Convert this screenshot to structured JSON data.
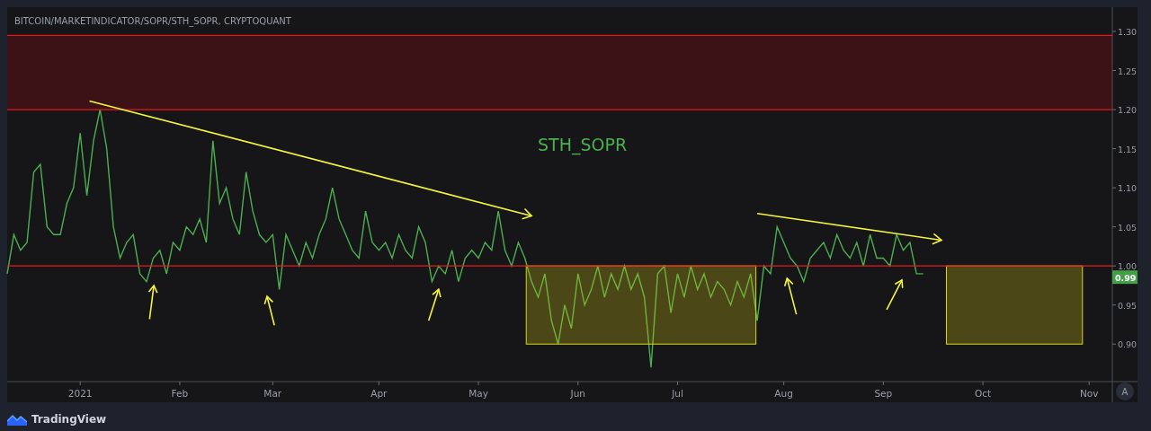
{
  "chart": {
    "chart_data": {
      "type": "line",
      "title": "BITCOIN/MARKETINDICATOR/SOPR/STH_SOPR, CRYPTOQUANT",
      "categories": [
        null,
        null,
        null,
        null,
        null,
        null,
        null,
        null,
        null,
        null,
        null,
        "2021",
        null,
        null,
        null,
        null,
        null,
        null,
        null,
        null,
        null,
        null,
        null,
        null,
        null,
        null,
        "Feb",
        null,
        null,
        null,
        null,
        null,
        null,
        null,
        null,
        null,
        null,
        null,
        null,
        null,
        "Mar",
        null,
        null,
        null,
        null,
        null,
        null,
        null,
        null,
        null,
        null,
        null,
        null,
        null,
        null,
        null,
        "Apr",
        null,
        null,
        null,
        null,
        null,
        null,
        null,
        null,
        null,
        null,
        null,
        null,
        null,
        null,
        "May",
        null,
        null,
        null,
        null,
        null,
        null,
        null,
        null,
        null,
        null,
        null,
        null,
        null,
        null,
        "Jun",
        null,
        null,
        null,
        null,
        null,
        null,
        null,
        null,
        null,
        null,
        null,
        null,
        null,
        null,
        "Jul",
        null,
        null,
        null,
        null,
        null,
        null,
        null,
        null,
        null,
        null,
        null,
        null,
        null,
        null,
        null,
        "Aug",
        null,
        null,
        null,
        null,
        null,
        null,
        null,
        null,
        null,
        null,
        null,
        null,
        null,
        null,
        "Sep",
        null,
        null,
        null,
        null,
        null,
        null,
        null,
        null,
        null,
        null,
        null,
        null,
        null,
        null,
        "Oct",
        null,
        null,
        null,
        null,
        null,
        null,
        null,
        null,
        null,
        null,
        null,
        null,
        null,
        null,
        null,
        "Nov",
        null,
        null,
        null
      ],
      "series": [
        {
          "name": "STH_SOPR",
          "color": "#4caf50",
          "values": [
            0.99,
            1.04,
            1.02,
            1.03,
            1.12,
            1.13,
            1.05,
            1.04,
            1.04,
            1.08,
            1.1,
            1.17,
            1.09,
            1.16,
            1.2,
            1.15,
            1.05,
            1.01,
            1.03,
            1.04,
            0.99,
            0.98,
            1.01,
            1.02,
            0.99,
            1.03,
            1.02,
            1.05,
            1.04,
            1.06,
            1.03,
            1.16,
            1.08,
            1.1,
            1.06,
            1.04,
            1.12,
            1.07,
            1.04,
            1.03,
            1.04,
            0.97,
            1.04,
            1.02,
            1.0,
            1.03,
            1.01,
            1.04,
            1.06,
            1.1,
            1.06,
            1.04,
            1.02,
            1.01,
            1.07,
            1.03,
            1.02,
            1.03,
            1.01,
            1.04,
            1.02,
            1.01,
            1.05,
            1.03,
            0.98,
            1.0,
            0.99,
            1.02,
            0.98,
            1.01,
            1.02,
            1.01,
            1.03,
            1.02,
            1.07,
            1.02,
            1.0,
            1.03,
            1.01,
            0.98,
            0.96,
            0.99,
            0.93,
            0.9,
            0.95,
            0.92,
            0.99,
            0.95,
            0.97,
            1.0,
            0.96,
            0.99,
            0.97,
            1.0,
            0.97,
            0.99,
            0.96,
            0.87,
            0.99,
            1.0,
            0.94,
            0.99,
            0.96,
            1.0,
            0.97,
            0.99,
            0.96,
            0.98,
            0.97,
            0.95,
            0.98,
            0.96,
            0.99,
            0.93,
            1.0,
            0.99,
            1.05,
            1.03,
            1.01,
            1.0,
            0.98,
            1.01,
            1.02,
            1.03,
            1.01,
            1.04,
            1.02,
            1.01,
            1.03,
            1.0,
            1.04,
            1.01,
            1.01,
            1.0,
            1.04,
            1.02,
            1.03,
            0.99,
            0.99,
            null,
            null,
            null,
            null,
            null,
            null,
            null,
            null,
            null,
            null,
            null,
            null,
            null,
            null,
            null,
            null,
            null,
            null,
            null,
            null,
            null,
            null,
            null,
            null,
            null,
            null,
            null,
            null
          ]
        }
      ],
      "ylim": [
        0.852,
        1.331
      ],
      "yticks": [
        {
          "value": 0.9,
          "label": "0.90"
        },
        {
          "value": 0.95,
          "label": "0.95"
        },
        {
          "value": 1.0,
          "label": "1.00"
        },
        {
          "value": 1.05,
          "label": "1.05"
        },
        {
          "value": 1.1,
          "label": "1.10"
        },
        {
          "value": 1.15,
          "label": "1.15"
        },
        {
          "value": 1.2,
          "label": "1.20"
        },
        {
          "value": 1.25,
          "label": "1.25"
        },
        {
          "value": 1.3,
          "label": "1.30"
        }
      ]
    },
    "last_value": "0.99",
    "auto_scale_button": "A"
  },
  "footer": {
    "brand": "TradingView"
  }
}
